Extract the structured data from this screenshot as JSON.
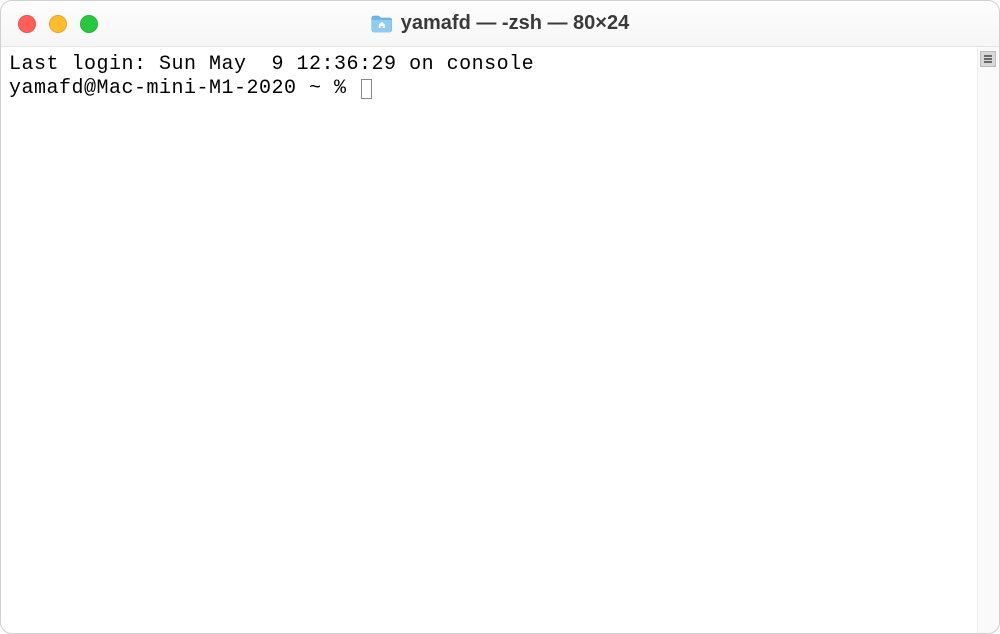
{
  "window": {
    "title": "yamafd — -zsh — 80×24"
  },
  "terminal": {
    "last_login_line": "Last login: Sun May  9 12:36:29 on console",
    "prompt": "yamafd@Mac-mini-M1-2020 ~ % "
  }
}
